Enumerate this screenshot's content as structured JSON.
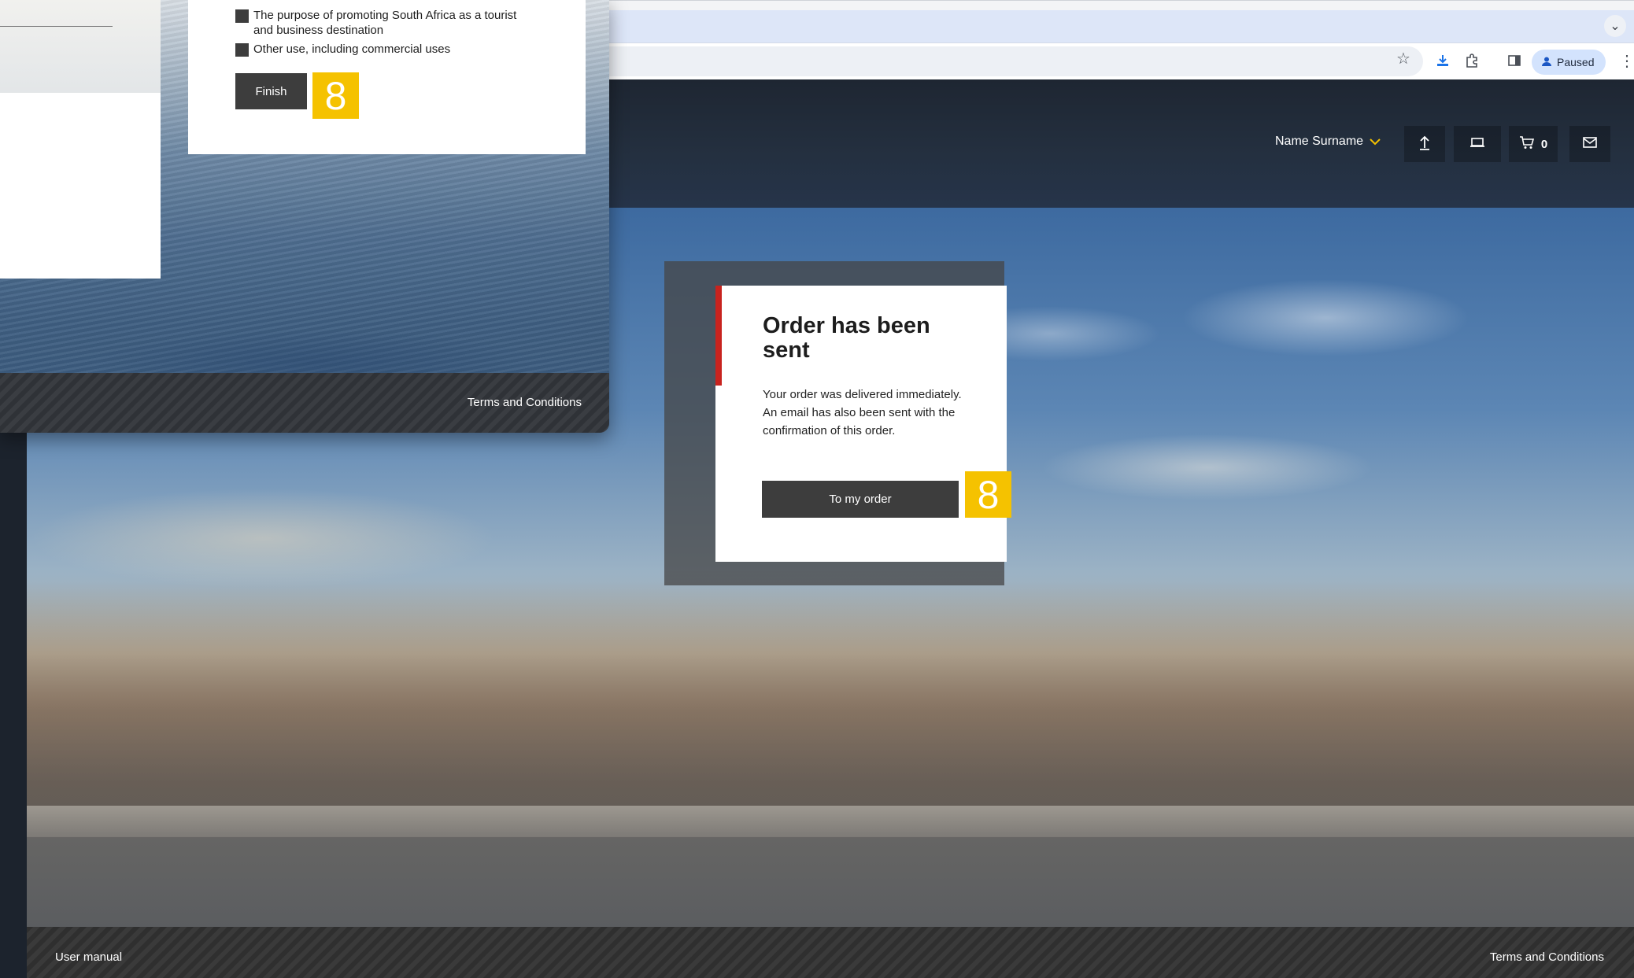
{
  "browser": {
    "profile_status": "Paused",
    "icons": [
      "star-icon",
      "download-icon",
      "puzzle-icon",
      "sidepanel-icon",
      "profile-icon",
      "kebab-icon",
      "chevron-down-icon"
    ]
  },
  "site_header": {
    "user_name": "Name Surname",
    "cart_count": "0",
    "icons": [
      "upload-icon",
      "device-icon",
      "cart-icon",
      "mail-icon"
    ]
  },
  "order_modal": {
    "title": "Order has been sent",
    "body": "Your order was delivered immediately. An email has also been sent with the confirmation of this order.",
    "button_label": "To my order",
    "step_badge": "8"
  },
  "front_window": {
    "checkbox_options": [
      "The purpose of promoting South Africa as a tourist and business destination",
      "Other use, including commercial uses"
    ],
    "finish_label": "Finish",
    "step_badge": "8",
    "footer_link": "Terms and Conditions"
  },
  "footer": {
    "user_manual": "User manual",
    "terms": "Terms and Conditions"
  },
  "colors": {
    "accent_yellow": "#f5c200",
    "accent_red": "#c8231e",
    "button_dark": "#3d3d3d"
  }
}
